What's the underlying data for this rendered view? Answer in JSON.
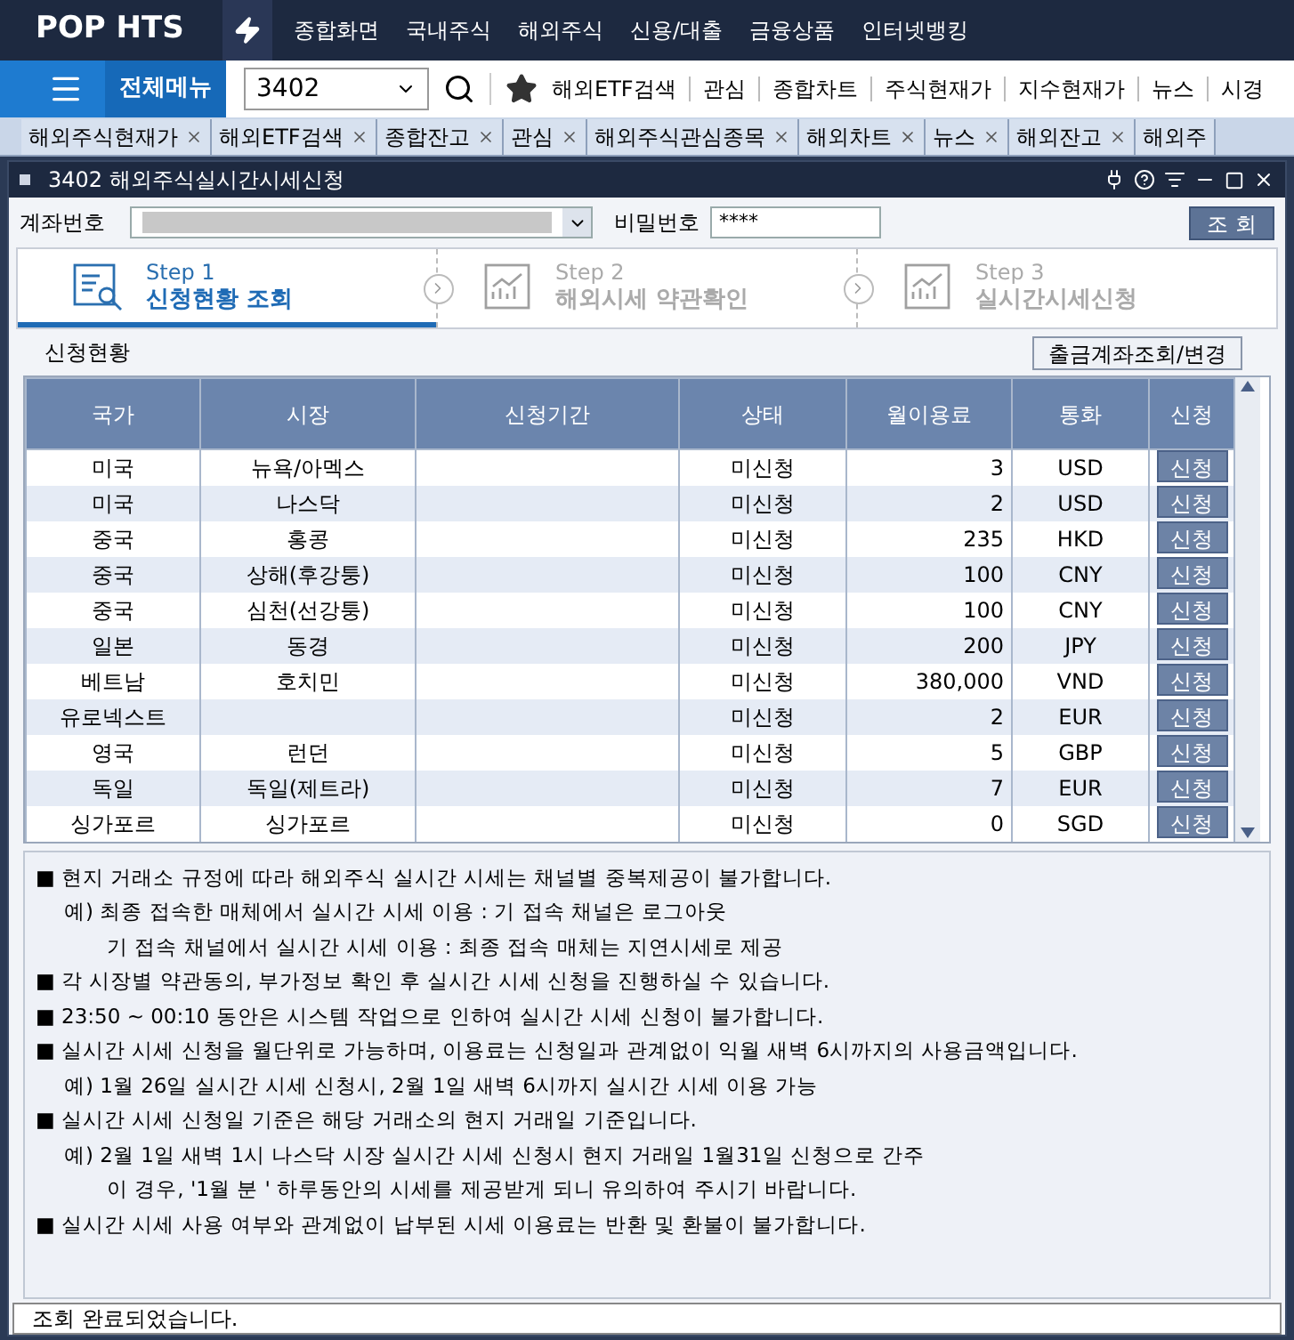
{
  "app_logo": "POP HTS",
  "top_menu": [
    "종합화면",
    "국내주식",
    "해외주식",
    "신용/대출",
    "금융상품",
    "인터넷뱅킹"
  ],
  "toolbar": {
    "menu_label": "전체메뉴",
    "screen_code": "3402",
    "shortcuts": [
      "해외ETF검색",
      "관심",
      "종합차트",
      "주식현재가",
      "지수현재가",
      "뉴스",
      "시경"
    ]
  },
  "tabs": [
    {
      "label": "해외주식현재가",
      "selected": false
    },
    {
      "label": "해외ETF검색",
      "selected": false
    },
    {
      "label": "종합잔고",
      "selected": false
    },
    {
      "label": "관심",
      "selected": false
    },
    {
      "label": "해외주식관심종목",
      "selected": false
    },
    {
      "label": "해외차트",
      "selected": false
    },
    {
      "label": "뉴스",
      "selected": false
    },
    {
      "label": "해외잔고",
      "selected": false
    },
    {
      "label": "해외주",
      "selected": false
    }
  ],
  "window": {
    "title": "3402 해외주식실시간시세신청"
  },
  "account": {
    "label": "계좌번호",
    "password_label": "비밀번호",
    "password": "****",
    "query_button": "조 회"
  },
  "steps": [
    {
      "step": "Step 1",
      "label": "신청현황 조회",
      "selected": true
    },
    {
      "step": "Step 2",
      "label": "해외시세 약관확인",
      "selected": false
    },
    {
      "step": "Step 3",
      "label": "실시간시세신청",
      "selected": false
    }
  ],
  "section": {
    "title": "신청현황",
    "button": "출금계좌조회/변경"
  },
  "table": {
    "columns": [
      "국가",
      "시장",
      "신청기간",
      "상태",
      "월이용료",
      "통화",
      "신청"
    ],
    "rows": [
      {
        "country": "미국",
        "market": "뉴욕/아멕스",
        "status": "미신청",
        "fee": "3",
        "currency": "USD",
        "action": "신청"
      },
      {
        "country": "미국",
        "market": "나스닥",
        "status": "미신청",
        "fee": "2",
        "currency": "USD",
        "action": "신청"
      },
      {
        "country": "중국",
        "market": "홍콩",
        "status": "미신청",
        "fee": "235",
        "currency": "HKD",
        "action": "신청"
      },
      {
        "country": "중국",
        "market": "상해(후강퉁)",
        "status": "미신청",
        "fee": "100",
        "currency": "CNY",
        "action": "신청"
      },
      {
        "country": "중국",
        "market": "심천(선강퉁)",
        "status": "미신청",
        "fee": "100",
        "currency": "CNY",
        "action": "신청"
      },
      {
        "country": "일본",
        "market": "동경",
        "status": "미신청",
        "fee": "200",
        "currency": "JPY",
        "action": "신청"
      },
      {
        "country": "베트남",
        "market": "호치민",
        "status": "미신청",
        "fee": "380,000",
        "currency": "VND",
        "action": "신청"
      },
      {
        "country": "유로넥스트",
        "status": "미신청",
        "fee": "2",
        "currency": "EUR",
        "action": "신청"
      },
      {
        "country": "영국",
        "market": "런던",
        "status": "미신청",
        "fee": "5",
        "currency": "GBP",
        "action": "신청"
      },
      {
        "country": "독일",
        "market": "독일(제트라)",
        "status": "미신청",
        "fee": "7",
        "currency": "EUR",
        "action": "신청"
      },
      {
        "country": "싱가포르",
        "market": "싱가포르",
        "status": "미신청",
        "fee": "0",
        "currency": "SGD",
        "action": "신청"
      }
    ]
  },
  "notes": [
    {
      "kind": "bullet",
      "text": "■ 현지 거래소 규정에 따라 해외주식 실시간 시세는 채널별 중복제공이 불가합니다."
    },
    {
      "kind": "example",
      "text": "예) 최종 접속한 매체에서 실시간 시세 이용 : 기 접속 채널은 로그아웃"
    },
    {
      "kind": "continuation",
      "text": "기 접속 채널에서 실시간 시세 이용 : 최종 접속 매체는 지연시세로 제공"
    },
    {
      "kind": "bullet",
      "text": "■ 각 시장별 약관동의, 부가정보 확인 후 실시간 시세 신청을 진행하실 수 있습니다."
    },
    {
      "kind": "bullet",
      "text": "■ 23:50 ~ 00:10 동안은 시스템 작업으로 인하여 실시간 시세 신청이 불가합니다."
    },
    {
      "kind": "bullet",
      "text": "■ 실시간 시세 신청을 월단위로 가능하며, 이용료는 신청일과 관계없이 익월 새벽 6시까지의 사용금액입니다."
    },
    {
      "kind": "example",
      "text": "예) 1월 26일 실시간 시세 신청시, 2월 1일 새벽 6시까지 실시간 시세 이용 가능"
    },
    {
      "kind": "bullet",
      "text": "■ 실시간 시세 신청일 기준은 해당 거래소의 현지 거래일 기준입니다."
    },
    {
      "kind": "example",
      "text": "예) 2월 1일 새벽 1시 나스닥 시장 실시간 시세 신청시 현지 거래일 1월31일 신청으로 간주"
    },
    {
      "kind": "continuation",
      "text": "이 경우, '1월 분 ' 하루동안의 시세를 제공받게 되니 유의하여 주시기 바랍니다."
    },
    {
      "kind": "bullet",
      "text": "■ 실시간 시세 사용 여부와 관계없이 납부된 시세 이용료는 반환 및 환불이 불가합니다."
    }
  ],
  "status_bar": "조회 완료되었습니다."
}
